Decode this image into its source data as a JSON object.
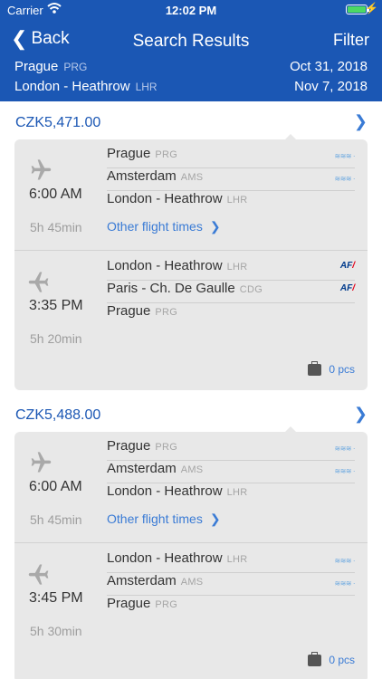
{
  "status_bar": {
    "carrier": "Carrier",
    "time": "12:02 PM"
  },
  "nav": {
    "back_label": "Back",
    "title": "Search Results",
    "filter_label": "Filter"
  },
  "route": [
    {
      "city": "Prague",
      "code": "PRG",
      "date": "Oct 31, 2018"
    },
    {
      "city": "London - Heathrow",
      "code": "LHR",
      "date": "Nov 7, 2018"
    }
  ],
  "results": [
    {
      "price": "CZK5,471.00",
      "legs": [
        {
          "time": "6:00 AM",
          "duration": "5h 45min",
          "stops": [
            {
              "city": "Prague",
              "code": "PRG",
              "airline": "KLM"
            },
            {
              "city": "Amsterdam",
              "code": "AMS",
              "airline": "KLM"
            },
            {
              "city": "London - Heathrow",
              "code": "LHR",
              "airline": ""
            }
          ],
          "other_times": "Other flight times"
        },
        {
          "time": "3:35 PM",
          "duration": "5h 20min",
          "stops": [
            {
              "city": "London - Heathrow",
              "code": "LHR",
              "airline": "AF"
            },
            {
              "city": "Paris - Ch. De Gaulle",
              "code": "CDG",
              "airline": "AF"
            },
            {
              "city": "Prague",
              "code": "PRG",
              "airline": ""
            }
          ],
          "bags": "0 pcs"
        }
      ]
    },
    {
      "price": "CZK5,488.00",
      "legs": [
        {
          "time": "6:00 AM",
          "duration": "5h 45min",
          "stops": [
            {
              "city": "Prague",
              "code": "PRG",
              "airline": "KLM"
            },
            {
              "city": "Amsterdam",
              "code": "AMS",
              "airline": "KLM"
            },
            {
              "city": "London - Heathrow",
              "code": "LHR",
              "airline": ""
            }
          ],
          "other_times": "Other flight times"
        },
        {
          "time": "3:45 PM",
          "duration": "5h 30min",
          "stops": [
            {
              "city": "London - Heathrow",
              "code": "LHR",
              "airline": "KLM"
            },
            {
              "city": "Amsterdam",
              "code": "AMS",
              "airline": "KLM"
            },
            {
              "city": "Prague",
              "code": "PRG",
              "airline": ""
            }
          ],
          "bags": "0 pcs"
        }
      ]
    }
  ],
  "logos": {
    "klm": "KLM",
    "af": "AF"
  }
}
